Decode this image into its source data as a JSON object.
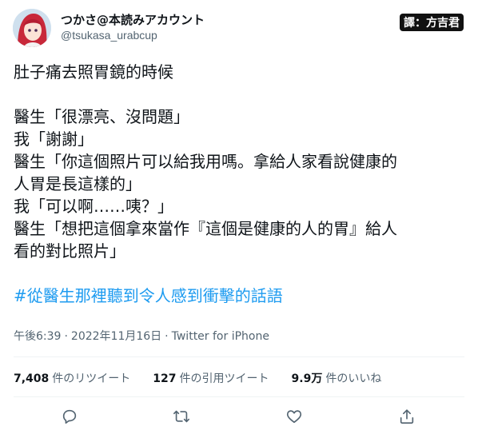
{
  "author": {
    "display_name": "つかさ@本読みアカウント",
    "handle": "@tsukasa_urabcup"
  },
  "translator_badge": "譯：方吉君",
  "tweet": {
    "lines": [
      "肚子痛去照胃鏡的時候",
      "",
      "醫生「很漂亮、沒問題」",
      "我「謝謝」",
      "醫生「你這個照片可以給我用嗎。拿給人家看說健康的",
      "人胃是長這樣的」",
      "我「可以啊……咦？」",
      "醫生「想把這個拿來當作『這個是健康的人的胃』給人",
      "看的對比照片」",
      ""
    ],
    "hashtag": "#從醫生那裡聽到令人感到衝擊的話語"
  },
  "meta": {
    "time": "午後6:39",
    "date": "2022年11月16日",
    "separator": "·",
    "source": "Twitter for iPhone"
  },
  "stats": {
    "retweets_count": "7,408",
    "retweets_label": "件のリツイート",
    "quotes_count": "127",
    "quotes_label": "件の引用ツイート",
    "likes_count": "9.9万",
    "likes_label": "件のいいね"
  },
  "icons": {
    "reply": "reply-icon",
    "retweet": "retweet-icon",
    "like": "heart-icon",
    "share": "share-icon"
  },
  "colors": {
    "hashtag": "#1d9bf0",
    "secondary_text": "#536471",
    "primary_text": "#0f1419"
  }
}
